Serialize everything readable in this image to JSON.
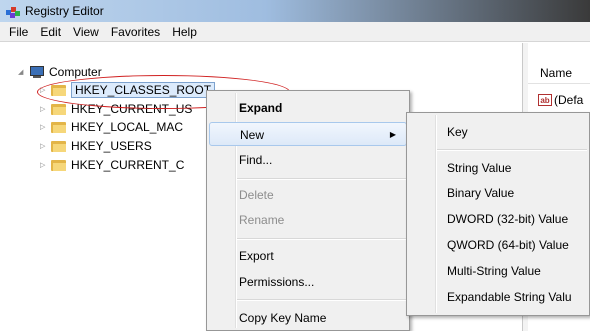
{
  "window": {
    "title": "Registry Editor"
  },
  "menubar": [
    "File",
    "Edit",
    "View",
    "Favorites",
    "Help"
  ],
  "tree": {
    "root": "Computer",
    "keys": [
      "HKEY_CLASSES_ROOT",
      "HKEY_CURRENT_US",
      "HKEY_LOCAL_MAC",
      "HKEY_USERS",
      "HKEY_CURRENT_C"
    ]
  },
  "right_pane": {
    "column_header": "Name",
    "value_icon": "ab",
    "value_name": "(Defa"
  },
  "context_menu": {
    "expand": "Expand",
    "new": "New",
    "find": "Find...",
    "delete": "Delete",
    "rename": "Rename",
    "export": "Export",
    "permissions": "Permissions...",
    "copy_key_name": "Copy Key Name"
  },
  "new_submenu": {
    "key": "Key",
    "string_value": "String Value",
    "binary_value": "Binary Value",
    "dword_value": "DWORD (32-bit) Value",
    "qword_value": "QWORD (64-bit) Value",
    "multi_string_value": "Multi-String Value",
    "expandable_string_value": "Expandable String Valu"
  },
  "icons": {
    "app": "registry-cubes-icon",
    "computer": "computer-icon",
    "folder": "folder-icon",
    "submenu_arrow": "chevron-right-icon"
  },
  "colors": {
    "annotation": "#d02020",
    "selection": "#dcebfc",
    "folder": "#e3b548"
  }
}
